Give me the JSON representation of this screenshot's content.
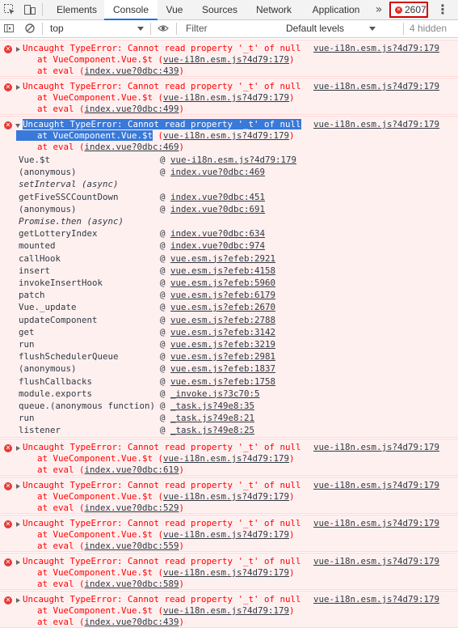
{
  "tabs": [
    "Elements",
    "Console",
    "Vue",
    "Sources",
    "Network",
    "Application"
  ],
  "active_tab": "Console",
  "more_tabs": "»",
  "error_count": "2607",
  "toolbar": {
    "context": "top",
    "filter_placeholder": "Filter",
    "levels": "Default levels",
    "hidden": "4 hidden"
  },
  "messages": [
    {
      "text": "Uncaught TypeError: Cannot read property '_t' of null",
      "source": "vue-i18n.esm.js?4d79:179",
      "frames": [
        [
          "at VueComponent.Vue.$t (",
          "vue-i18n.esm.js?4d79:179",
          ")"
        ],
        [
          "at eval (",
          "index.vue?0dbc:439",
          ")"
        ]
      ]
    },
    {
      "text": "Uncaught TypeError: Cannot read property '_t' of null",
      "source": "vue-i18n.esm.js?4d79:179",
      "frames": [
        [
          "at VueComponent.Vue.$t (",
          "vue-i18n.esm.js?4d79:179",
          ")"
        ],
        [
          "at eval (",
          "index.vue?0dbc:499",
          ")"
        ]
      ]
    },
    {
      "text": "Uncaught TypeError: Cannot read property '_t' of null",
      "source": "vue-i18n.esm.js?4d79:179",
      "frames": [
        [
          "at VueComponent.Vue.$t",
          "vue-i18n.esm.js?4d79:179",
          ")"
        ],
        [
          "at eval (",
          "index.vue?0dbc:469",
          ")"
        ]
      ],
      "expanded_stack": [
        {
          "fn": "Vue.$t",
          "loc": "vue-i18n.esm.js?4d79:179"
        },
        {
          "fn": "(anonymous)",
          "loc": "index.vue?0dbc:469"
        },
        {
          "fn": "setInterval (async)",
          "loc": ""
        },
        {
          "fn": "getFiveSSCCountDown",
          "loc": "index.vue?0dbc:451"
        },
        {
          "fn": "(anonymous)",
          "loc": "index.vue?0dbc:691"
        },
        {
          "fn": "Promise.then (async)",
          "loc": ""
        },
        {
          "fn": "getLotteryIndex",
          "loc": "index.vue?0dbc:634"
        },
        {
          "fn": "mounted",
          "loc": "index.vue?0dbc:974"
        },
        {
          "fn": "callHook",
          "loc": "vue.esm.js?efeb:2921"
        },
        {
          "fn": "insert",
          "loc": "vue.esm.js?efeb:4158"
        },
        {
          "fn": "invokeInsertHook",
          "loc": "vue.esm.js?efeb:5960"
        },
        {
          "fn": "patch",
          "loc": "vue.esm.js?efeb:6179"
        },
        {
          "fn": "Vue._update",
          "loc": "vue.esm.js?efeb:2670"
        },
        {
          "fn": "updateComponent",
          "loc": "vue.esm.js?efeb:2788"
        },
        {
          "fn": "get",
          "loc": "vue.esm.js?efeb:3142"
        },
        {
          "fn": "run",
          "loc": "vue.esm.js?efeb:3219"
        },
        {
          "fn": "flushSchedulerQueue",
          "loc": "vue.esm.js?efeb:2981"
        },
        {
          "fn": "(anonymous)",
          "loc": "vue.esm.js?efeb:1837"
        },
        {
          "fn": "flushCallbacks",
          "loc": "vue.esm.js?efeb:1758"
        },
        {
          "fn": "module.exports",
          "loc": "_invoke.js?3c70:5"
        },
        {
          "fn": "queue.(anonymous function)",
          "loc": "_task.js?49e8:35"
        },
        {
          "fn": "run",
          "loc": "_task.js?49e8:21"
        },
        {
          "fn": "listener",
          "loc": "_task.js?49e8:25"
        }
      ]
    },
    {
      "text": "Uncaught TypeError: Cannot read property '_t' of null",
      "source": "vue-i18n.esm.js?4d79:179",
      "frames": [
        [
          "at VueComponent.Vue.$t (",
          "vue-i18n.esm.js?4d79:179",
          ")"
        ],
        [
          "at eval (",
          "index.vue?0dbc:619",
          ")"
        ]
      ]
    },
    {
      "text": "Uncaught TypeError: Cannot read property '_t' of null",
      "source": "vue-i18n.esm.js?4d79:179",
      "frames": [
        [
          "at VueComponent.Vue.$t (",
          "vue-i18n.esm.js?4d79:179",
          ")"
        ],
        [
          "at eval (",
          "index.vue?0dbc:529",
          ")"
        ]
      ]
    },
    {
      "text": "Uncaught TypeError: Cannot read property '_t' of null",
      "source": "vue-i18n.esm.js?4d79:179",
      "frames": [
        [
          "at VueComponent.Vue.$t (",
          "vue-i18n.esm.js?4d79:179",
          ")"
        ],
        [
          "at eval (",
          "index.vue?0dbc:559",
          ")"
        ]
      ]
    },
    {
      "text": "Uncaught TypeError: Cannot read property '_t' of null",
      "source": "vue-i18n.esm.js?4d79:179",
      "frames": [
        [
          "at VueComponent.Vue.$t (",
          "vue-i18n.esm.js?4d79:179",
          ")"
        ],
        [
          "at eval (",
          "index.vue?0dbc:589",
          ")"
        ]
      ]
    },
    {
      "text": "Uncaught TypeError: Cannot read property '_t' of null",
      "source": "vue-i18n.esm.js?4d79:179",
      "frames": [
        [
          "at VueComponent.Vue.$t (",
          "vue-i18n.esm.js?4d79:179",
          ")"
        ],
        [
          "at eval (",
          "index.vue?0dbc:439",
          ")"
        ]
      ]
    }
  ]
}
